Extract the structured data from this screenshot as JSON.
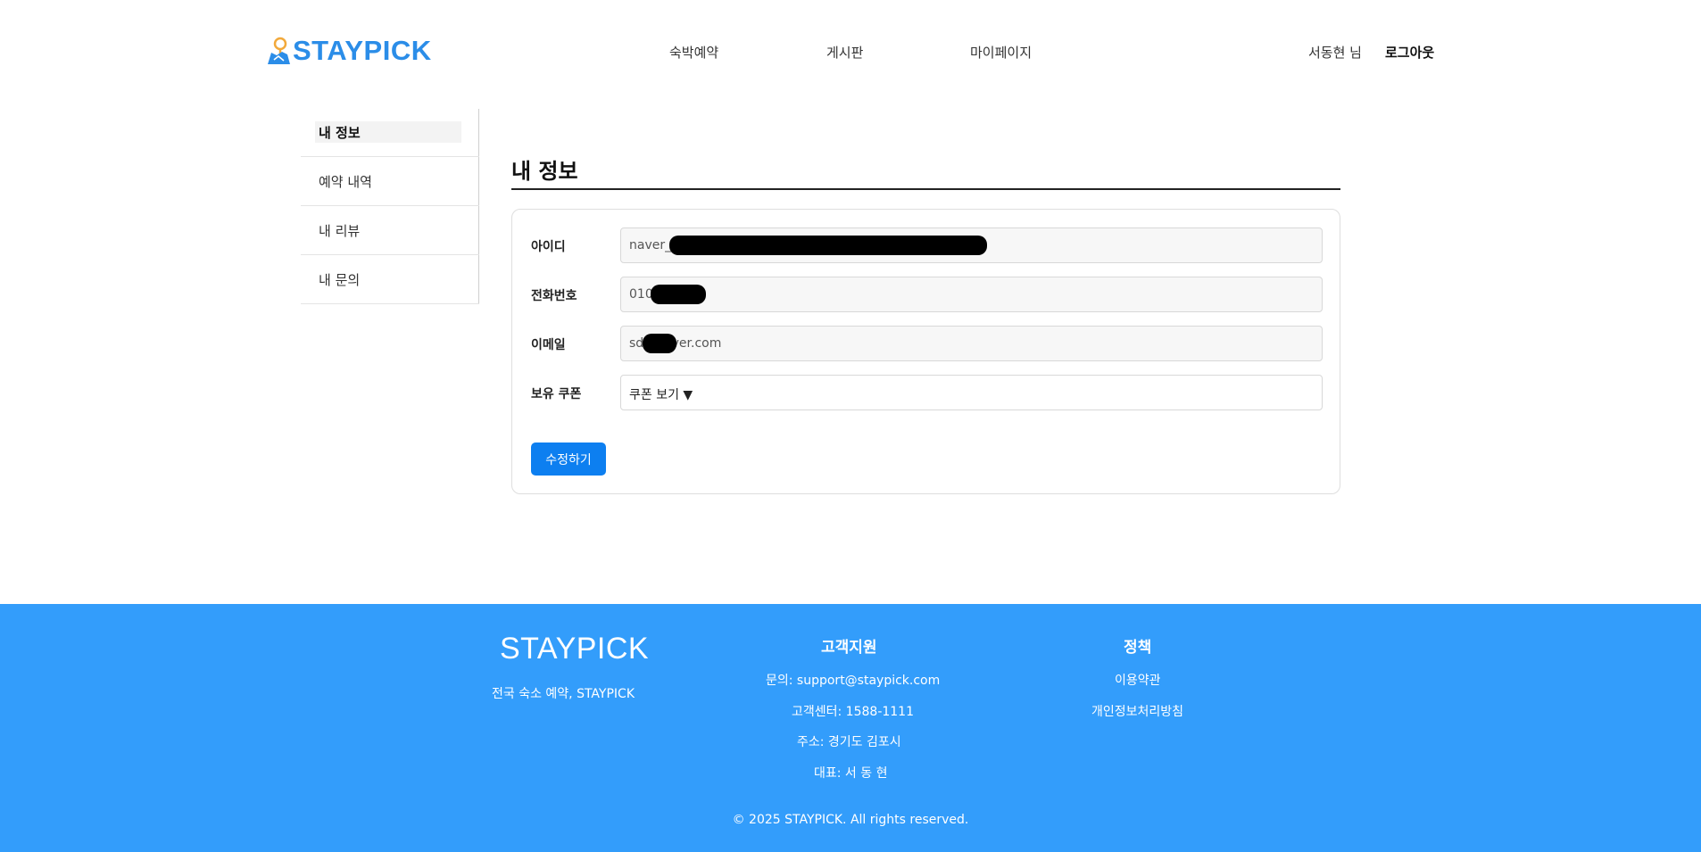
{
  "header": {
    "logo_text": "STAYPICK",
    "nav": [
      "숙박예약",
      "게시판",
      "마이페이지"
    ],
    "user_name": "서동현 님",
    "logout_label": "로그아웃"
  },
  "sidebar": {
    "items": [
      {
        "label": "내 정보",
        "active": true
      },
      {
        "label": "예약 내역",
        "active": false
      },
      {
        "label": "내 리뷰",
        "active": false
      },
      {
        "label": "내 문의",
        "active": false
      }
    ]
  },
  "main": {
    "title": "내 정보",
    "fields": [
      {
        "label": "아이디",
        "value": "naver_"
      },
      {
        "label": "전화번호",
        "value": "010"
      },
      {
        "label": "이메일",
        "value": "sd@naver.com"
      },
      {
        "label": "보유 쿠폰",
        "value": "쿠폰 보기 ▼"
      }
    ],
    "edit_button": "수정하기"
  },
  "footer": {
    "brand": "STAYPICK",
    "tagline": "전국 숙소 예약, STAYPICK",
    "support": {
      "title": "고객지원",
      "lines": [
        "문의: support@staypick.com",
        "고객센터: 1588-1111",
        "주소: 경기도 김포시",
        "대표: 서 동 현"
      ]
    },
    "policy": {
      "title": "정책",
      "links": [
        "이용약관",
        "개인정보처리방침"
      ]
    },
    "copyright": "© 2025 STAYPICK. All rights reserved."
  },
  "colors": {
    "brand": "#2b8de8",
    "footer_bg": "#339dfb",
    "button": "#0d7ff0"
  }
}
